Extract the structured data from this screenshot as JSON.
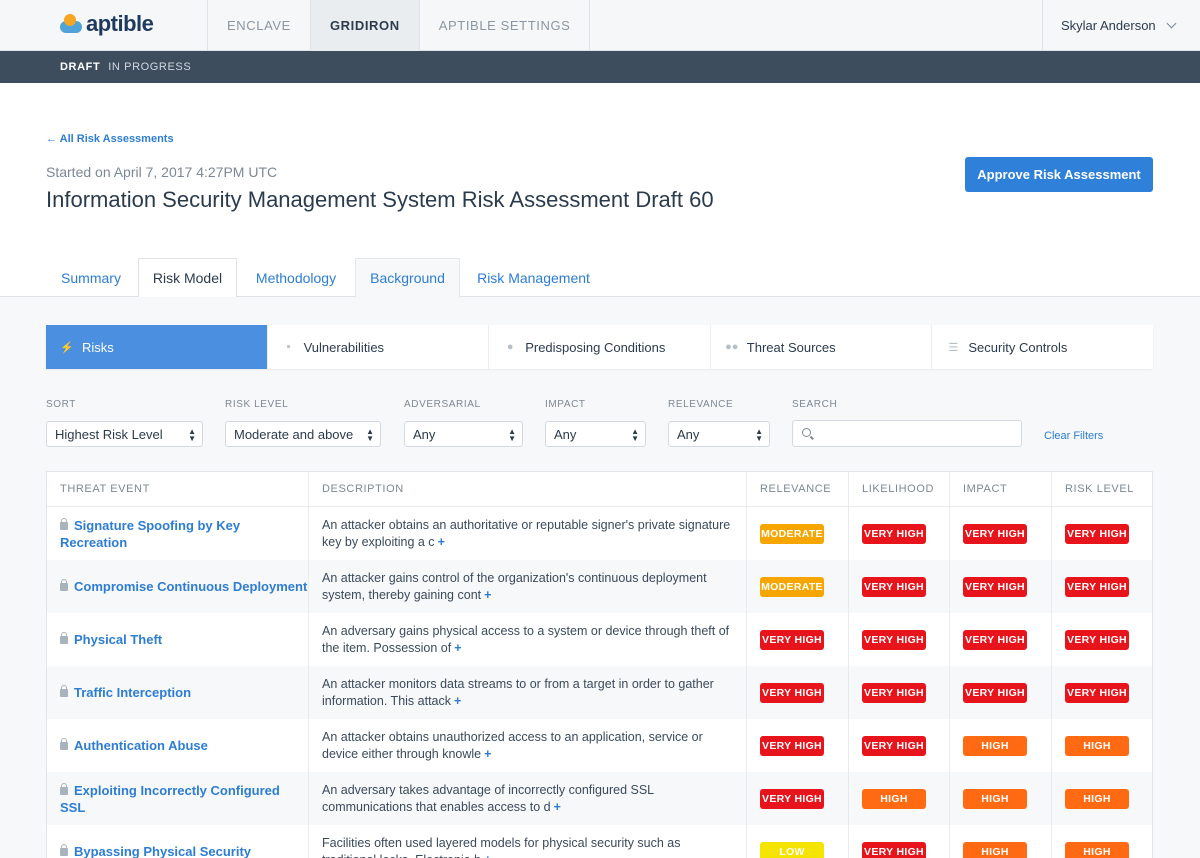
{
  "app": {
    "brand": "aptible"
  },
  "nav": {
    "tabs": [
      "ENCLAVE",
      "GRIDIRON",
      "APTIBLE SETTINGS"
    ],
    "active": "GRIDIRON",
    "user": "Skylar Anderson"
  },
  "status": {
    "draft": "DRAFT",
    "state": "IN PROGRESS"
  },
  "page": {
    "back": "← All Risk Assessments",
    "started": "Started on April 7, 2017 4:27PM UTC",
    "title": "Information Security Management System Risk Assessment Draft 60",
    "approve": "Approve Risk Assessment"
  },
  "tabs": [
    "Summary",
    "Risk Model",
    "Methodology",
    "Background",
    "Risk Management"
  ],
  "subtabs": [
    {
      "label": "Risks",
      "icon": "lightning-icon",
      "glyph": "⚡"
    },
    {
      "label": "Vulnerabilities",
      "icon": "unlock-icon",
      "glyph": "🔓"
    },
    {
      "label": "Predisposing Conditions",
      "icon": "globe-icon",
      "glyph": "●"
    },
    {
      "label": "Threat Sources",
      "icon": "users-icon",
      "glyph": "👥"
    },
    {
      "label": "Security Controls",
      "icon": "sliders-icon",
      "glyph": "☰"
    }
  ],
  "filters": {
    "sort": {
      "label": "SORT",
      "value": "Highest Risk Level"
    },
    "risk_level": {
      "label": "RISK LEVEL",
      "value": "Moderate and above"
    },
    "adversarial": {
      "label": "ADVERSARIAL",
      "value": "Any"
    },
    "impact": {
      "label": "IMPACT",
      "value": "Any"
    },
    "relevance": {
      "label": "RELEVANCE",
      "value": "Any"
    },
    "search": {
      "label": "SEARCH",
      "placeholder": ""
    },
    "clear": "Clear Filters"
  },
  "table": {
    "headers": [
      "THREAT EVENT",
      "DESCRIPTION",
      "RELEVANCE",
      "LIKELIHOOD",
      "IMPACT",
      "RISK LEVEL"
    ],
    "rows": [
      {
        "event": "Signature Spoofing by Key Recreation",
        "desc": "An attacker obtains an authoritative or reputable signer's private signature key by exploiting a c",
        "relevance": "MODERATE",
        "likelihood": "VERY HIGH",
        "impact": "VERY HIGH",
        "risk": "VERY HIGH"
      },
      {
        "event": "Compromise Continuous Deployment",
        "desc": "An attacker gains control of the organization's continuous deployment system, thereby gaining cont",
        "relevance": "MODERATE",
        "likelihood": "VERY HIGH",
        "impact": "VERY HIGH",
        "risk": "VERY HIGH"
      },
      {
        "event": "Physical Theft",
        "desc": "An adversary gains physical access to a system or device through theft of the item. Possession of",
        "relevance": "VERY HIGH",
        "likelihood": "VERY HIGH",
        "impact": "VERY HIGH",
        "risk": "VERY HIGH"
      },
      {
        "event": "Traffic Interception",
        "desc": "An attacker monitors data streams to or from a target in order to gather information. This attack",
        "relevance": "VERY HIGH",
        "likelihood": "VERY HIGH",
        "impact": "VERY HIGH",
        "risk": "VERY HIGH"
      },
      {
        "event": "Authentication Abuse",
        "desc": "An attacker obtains unauthorized access to an application, service or device either through knowle",
        "relevance": "VERY HIGH",
        "likelihood": "VERY HIGH",
        "impact": "HIGH",
        "risk": "HIGH"
      },
      {
        "event": "Exploiting Incorrectly Configured SSL",
        "desc": "An adversary takes advantage of incorrectly configured SSL communications that enables access to d",
        "relevance": "VERY HIGH",
        "likelihood": "HIGH",
        "impact": "HIGH",
        "risk": "HIGH"
      },
      {
        "event": "Bypassing Physical Security",
        "desc": "Facilities often used layered models for physical security such as traditional locks, Electronic-b",
        "relevance": "LOW",
        "likelihood": "VERY HIGH",
        "impact": "HIGH",
        "risk": "HIGH"
      }
    ]
  },
  "colors": {
    "very_high": "#e8141c",
    "high": "#ff6a13",
    "moderate": "#f7a600",
    "low": "#f5e400",
    "accent": "#2f80d8"
  }
}
